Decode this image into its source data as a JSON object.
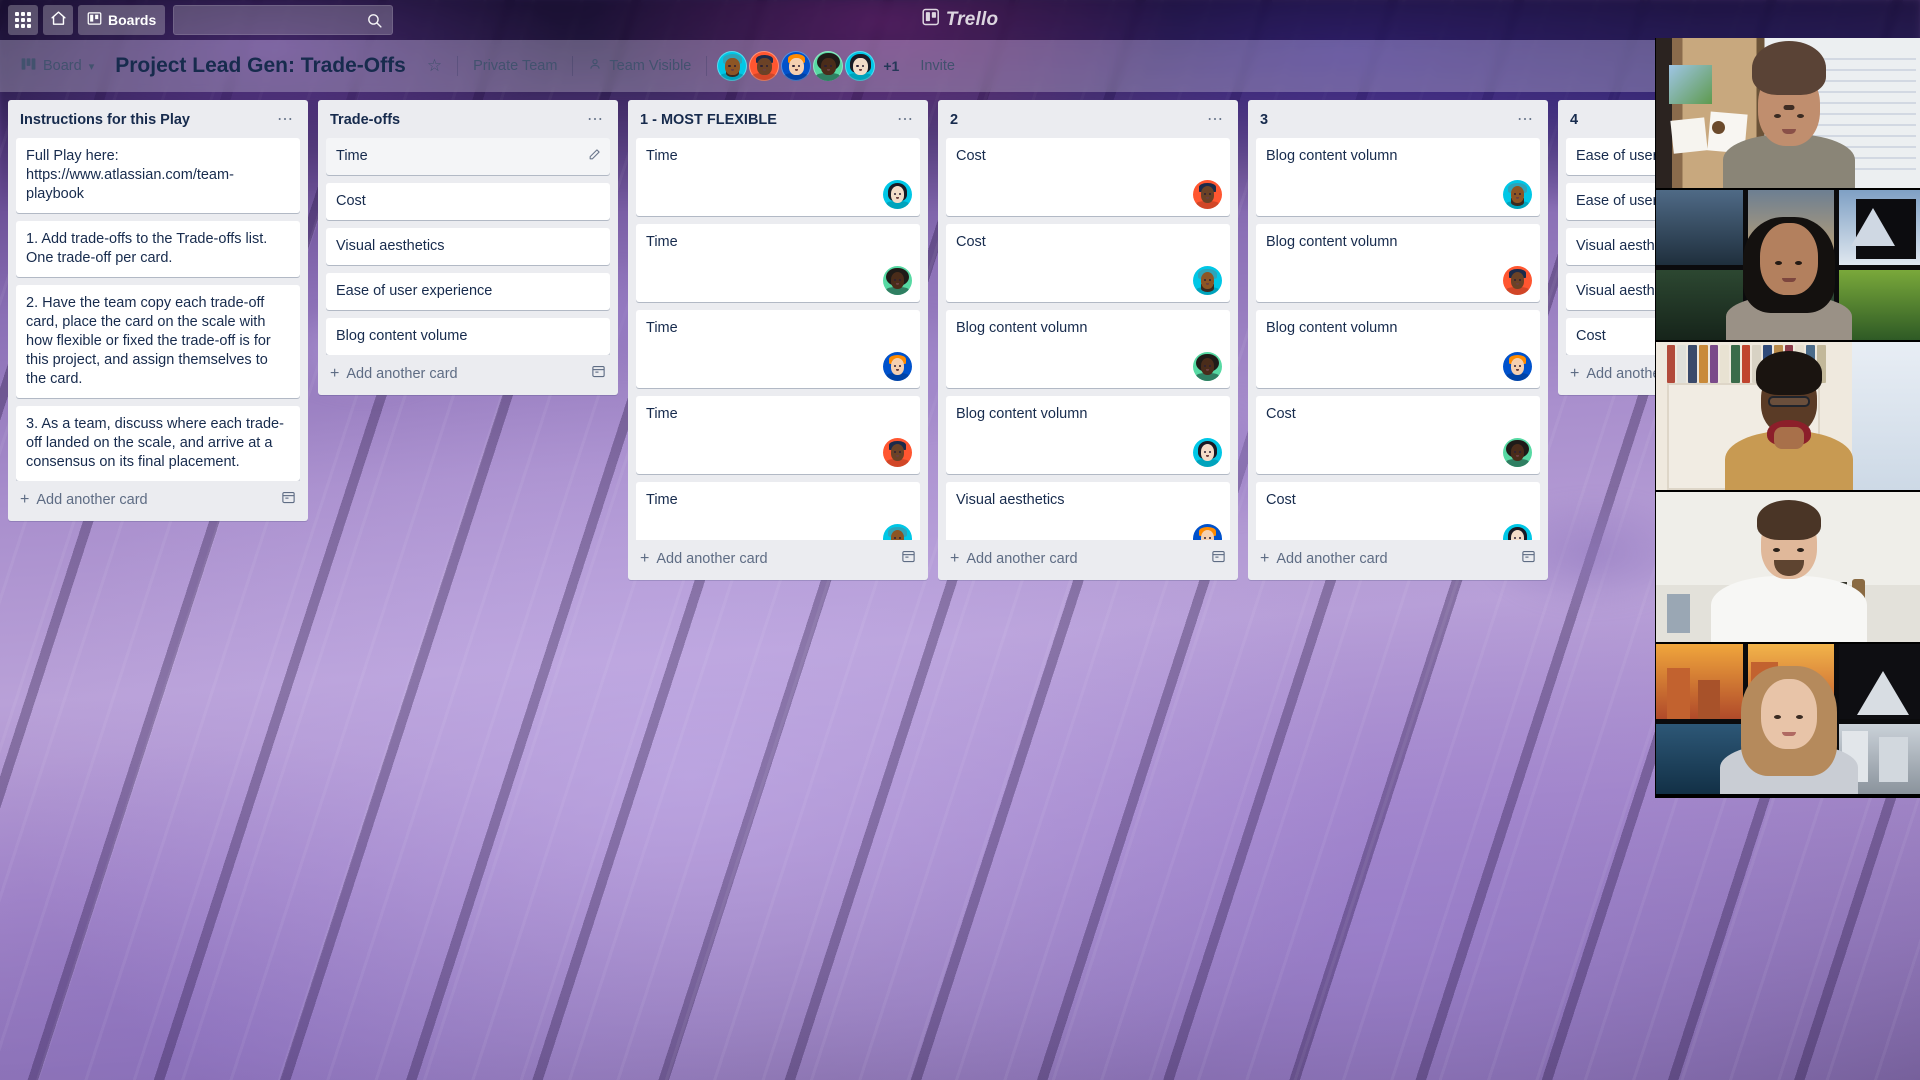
{
  "topbar": {
    "apps_icon": "grid-apps-icon",
    "home_icon": "home-icon",
    "boards_icon": "board-icon",
    "boards_label": "Boards",
    "search_placeholder": "",
    "search_value": "",
    "search_icon": "search-icon",
    "logo_text": "Trello",
    "logo_icon": "trello-logo-icon"
  },
  "board_header": {
    "board_menu_icon": "board-icon",
    "board_menu_label": "Board",
    "board_menu_caret": "chevron-down-icon",
    "title": "Project Lead Gen: Trade-Offs",
    "star_icon": "star-icon",
    "visibility_team": "Private Team",
    "visibility_icon": "person-icon",
    "visibility_label": "Team Visible",
    "members_overflow": "+1",
    "invite_label": "Invite",
    "members": [
      {
        "name": "member-1",
        "bg": "#00c7e6",
        "hair": "#2ea3b8",
        "skin": "#8d5524",
        "style": "turban-beard"
      },
      {
        "name": "member-2",
        "bg": "#ff5630",
        "hair": "#1b2a4a",
        "skin": "#6b4226",
        "style": "short-dark"
      },
      {
        "name": "member-3",
        "bg": "#0052cc",
        "hair": "#ff8b00",
        "skin": "#f5d0b0",
        "style": "ginger"
      },
      {
        "name": "member-4",
        "bg": "#57d9a3",
        "hair": "#1f1b18",
        "skin": "#4a2c1a",
        "style": "afro"
      },
      {
        "name": "member-5",
        "bg": "#00c7e6",
        "hair": "#1a1a24",
        "skin": "#f3dcc8",
        "style": "black-bob"
      }
    ]
  },
  "lists": [
    {
      "title": "Instructions for this Play",
      "menu_icon": "list-menu-icon",
      "add_label": "Add another card",
      "add_icon": "plus-icon",
      "template_icon": "card-template-icon",
      "cards": [
        {
          "text": "Full Play here: https://www.atlassian.com/team-playbook",
          "avatar": null
        },
        {
          "text": "1. Add trade-offs to the Trade-offs list. One trade-off per card.",
          "avatar": null
        },
        {
          "text": "2. Have the team copy each trade-off card, place the card on the scale with how flexible or fixed the trade-off is for this project, and assign themselves to the card.",
          "avatar": null
        },
        {
          "text": "3. As a team, discuss where each trade-off landed on the scale, and arrive at a consensus on its final placement.",
          "avatar": null
        }
      ]
    },
    {
      "title": "Trade-offs",
      "menu_icon": "list-menu-icon",
      "add_label": "Add another card",
      "add_icon": "plus-icon",
      "template_icon": "card-template-icon",
      "cards": [
        {
          "text": "Time",
          "avatar": null,
          "hover": true,
          "edit_icon": "pencil-icon"
        },
        {
          "text": "Cost",
          "avatar": null
        },
        {
          "text": "Visual aesthetics",
          "avatar": null
        },
        {
          "text": "Ease of user experience",
          "avatar": null
        },
        {
          "text": "Blog content volume",
          "avatar": null
        }
      ]
    },
    {
      "title": "1 - MOST FLEXIBLE",
      "menu_icon": "list-menu-icon",
      "add_label": "Add another card",
      "add_icon": "plus-icon",
      "template_icon": "card-template-icon",
      "cards": [
        {
          "text": "Time",
          "avatar": 4
        },
        {
          "text": "Time",
          "avatar": 3
        },
        {
          "text": "Time",
          "avatar": 2
        },
        {
          "text": "Time",
          "avatar": 1
        },
        {
          "text": "Time",
          "avatar": 0
        }
      ]
    },
    {
      "title": "2",
      "menu_icon": "list-menu-icon",
      "add_label": "Add another card",
      "add_icon": "plus-icon",
      "template_icon": "card-template-icon",
      "cards": [
        {
          "text": "Cost",
          "avatar": 1
        },
        {
          "text": "Cost",
          "avatar": 0
        },
        {
          "text": "Blog content volumn",
          "avatar": 3
        },
        {
          "text": "Blog content volumn",
          "avatar": 4
        },
        {
          "text": "Visual aesthetics",
          "avatar": 2
        }
      ]
    },
    {
      "title": "3",
      "menu_icon": "list-menu-icon",
      "add_label": "Add another card",
      "add_icon": "plus-icon",
      "template_icon": "card-template-icon",
      "cards": [
        {
          "text": "Blog content volumn",
          "avatar": 0
        },
        {
          "text": "Blog content volumn",
          "avatar": 1
        },
        {
          "text": "Blog content volumn",
          "avatar": 2
        },
        {
          "text": "Cost",
          "avatar": 3
        },
        {
          "text": "Cost",
          "avatar": 4
        }
      ]
    },
    {
      "title": "4",
      "menu_icon": "list-menu-icon",
      "add_label": "Add another card",
      "add_icon": "plus-icon",
      "template_icon": "card-template-icon",
      "cards": [
        {
          "text": "Ease of user experience",
          "avatar": null
        },
        {
          "text": "Ease of user experience",
          "avatar": null
        },
        {
          "text": "Visual aesthetics",
          "avatar": null
        },
        {
          "text": "Visual aesthetics",
          "avatar": null
        },
        {
          "text": "Cost",
          "avatar": null
        }
      ]
    }
  ],
  "video_panel": {
    "name": "video-call-panel",
    "participants": [
      {
        "name": "participant-1",
        "scene": "whiteboard-corkboard",
        "skin": "#c08e6e",
        "hair": "#5a4336",
        "top": "#8a8577"
      },
      {
        "name": "participant-2",
        "scene": "mountain-window",
        "skin": "#b3805e",
        "hair": "#14110f",
        "top": "#9a9186"
      },
      {
        "name": "participant-3",
        "scene": "bookshelf-door",
        "skin": "#5a3b26",
        "hair": "#1a1410",
        "top": "#c89a52"
      },
      {
        "name": "participant-4",
        "scene": "plain-room",
        "skin": "#e0b89a",
        "hair": "#4a3526",
        "top": "#f7f7f5"
      },
      {
        "name": "participant-5",
        "scene": "city-skyline-window",
        "skin": "#e8c4a8",
        "hair": "#b58a5c",
        "top": "#c9cdd4"
      }
    ]
  }
}
